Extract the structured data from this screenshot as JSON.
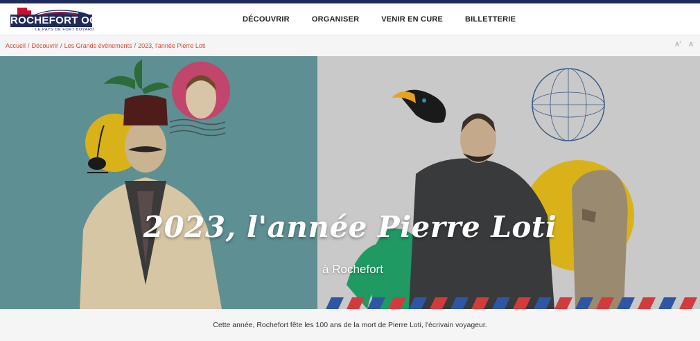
{
  "brand": {
    "name": "ROCHEFORT OCÉAN",
    "tagline": "LE PAYS DE FORT BOYARD",
    "colors": {
      "navy": "#1f2a5c",
      "red": "#c8102e",
      "accent": "#d4482e"
    }
  },
  "nav": {
    "items": [
      {
        "label": "DÉCOUVRIR"
      },
      {
        "label": "ORGANISER"
      },
      {
        "label": "VENIR EN CURE"
      },
      {
        "label": "BILLETTERIE"
      }
    ]
  },
  "breadcrumb": {
    "items": [
      {
        "label": "Accueil"
      },
      {
        "label": "Découvrir"
      },
      {
        "label": "Les Grands évènements"
      },
      {
        "label": "2023, l'année Pierre Loti"
      }
    ],
    "separator": "/"
  },
  "font_size_controls": {
    "increase": "A",
    "decrease": "A",
    "increase_sign": "+",
    "decrease_sign": "-"
  },
  "hero": {
    "title": "2023, l'année Pierre Loti",
    "subtitle": "à Rochefort",
    "colors": {
      "left_bg": "#5e8f93",
      "right_bg": "#c9c9c9",
      "yellow": "#d9b21a",
      "pink": "#c2456b",
      "green": "#1f9a63"
    }
  },
  "intro": {
    "text": "Cette année, Rochefort fête les 100 ans de la mort de Pierre Loti, l'écrivain voyageur."
  }
}
